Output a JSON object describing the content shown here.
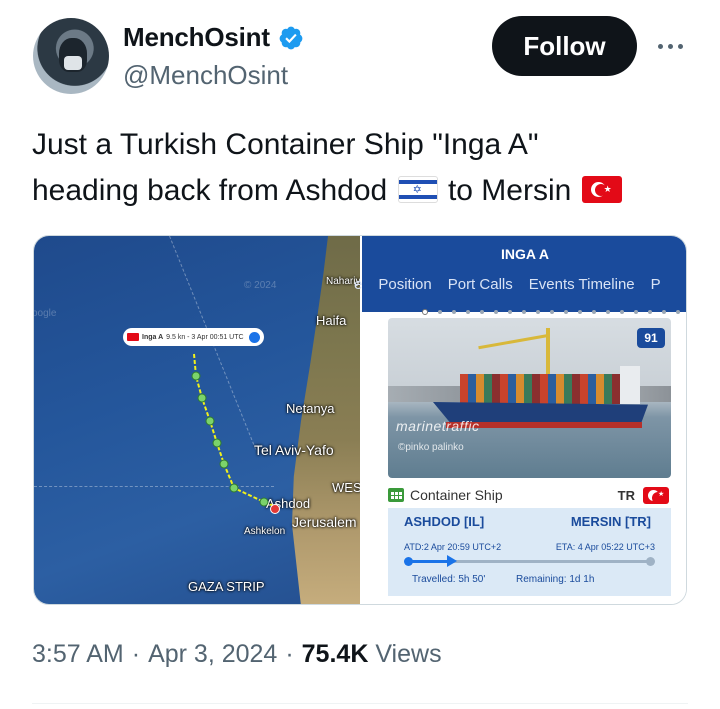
{
  "author": {
    "display_name": "MenchOsint",
    "handle": "@MenchOsint",
    "verified_icon": "verified-badge-icon",
    "verified_color": "#1d9bf0"
  },
  "actions": {
    "follow_label": "Follow",
    "more_icon": "more-horizontal-icon"
  },
  "tweet": {
    "text_line1": "Just a Turkish Container Ship \"Inga A\"",
    "text_line2_a": "heading back from Ashdod",
    "text_line2_b": "to Mersin",
    "flag_1": "israel-flag-icon",
    "flag_2": "turkey-flag-icon"
  },
  "media": {
    "map": {
      "labels": {
        "nahariya": "Nahariya",
        "haifa": "Haifa",
        "netanya": "Netanya",
        "tel_aviv": "Tel Aviv-Yafo",
        "west": "WES",
        "ashdod": "Ashdod",
        "jerusalem": "Jerusalem",
        "ashkelon": "Ashkelon",
        "gaza": "GAZA STRIP",
        "watermark": "© 2024",
        "google": "oogle"
      },
      "ship_label": {
        "name": "Inga A",
        "info": "9.5 kn - 3 Apr 00:51 UTC"
      }
    },
    "panel": {
      "title": "INGA A",
      "tabs": [
        "e",
        "Position",
        "Port Calls",
        "Events Timeline",
        "P"
      ],
      "badge": "91",
      "watermark": "marinetraffic",
      "photo_credit": "©pinko palinko",
      "vessel_type": "Container Ship",
      "flag_code": "TR",
      "route": {
        "from": "ASHDOD [IL]",
        "to": "MERSIN [TR]",
        "atd": "ATD:2 Apr 20:59 UTC+2",
        "eta": "ETA: 4 Apr 05:22 UTC+3",
        "travelled": "Travelled: 5h 50'",
        "remaining": "Remaining: 1d 1h",
        "progress_fraction": 0.19
      }
    }
  },
  "meta": {
    "time": "3:57 AM",
    "sep1": "·",
    "date": "Apr 3, 2024",
    "sep2": "·",
    "views_count": "75.4K",
    "views_label": "Views"
  }
}
